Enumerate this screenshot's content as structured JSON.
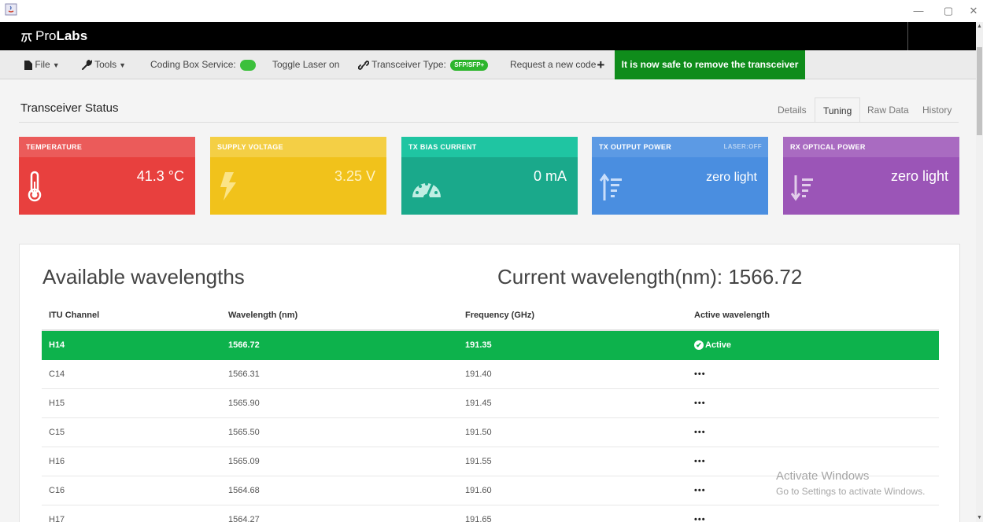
{
  "window": {
    "minimize_glyph": "—",
    "maximize_glyph": "▢",
    "close_glyph": "✕"
  },
  "brand": {
    "name_light": "Pro",
    "name_bold": "Labs"
  },
  "toolbar": {
    "file_label": "File",
    "tools_label": "Tools",
    "coding_box_label": "Coding Box Service:",
    "toggle_laser_label": "Toggle Laser on",
    "transceiver_type_label": "Transceiver Type:",
    "transceiver_type_badge": "SFP/SFP+",
    "request_code_label": "Request a new code",
    "safe_remove_banner": "It is now safe to remove the transceiver"
  },
  "status": {
    "title": "Transceiver Status",
    "tabs": [
      "Details",
      "Tuning",
      "Raw Data",
      "History"
    ],
    "active_tab": "Tuning"
  },
  "tiles": {
    "temperature": {
      "label": "TEMPERATURE",
      "value": "41.3 °C",
      "color": "#e8403e",
      "head_color": "#eb5b5a",
      "icon": "thermometer-icon"
    },
    "voltage": {
      "label": "SUPPLY VOLTAGE",
      "value": "3.25 V",
      "color": "#f1c21b",
      "head_color": "#f4cf45",
      "icon": "lightning-icon"
    },
    "bias": {
      "label": "TX BIAS CURRENT",
      "value": "0 mA",
      "color": "#1aa98b",
      "head_color": "#1fc5a2",
      "icon": "gauge-icon"
    },
    "tx_power": {
      "label": "TX OUTPUT POWER",
      "badge": "LASER:OFF",
      "value": "zero light",
      "color": "#4a8ee0",
      "head_color": "#5c9ae4",
      "icon": "sort-ascending-icon"
    },
    "rx_power": {
      "label": "RX OPTICAL POWER",
      "value": "zero light",
      "color": "#9b55b7",
      "head_color": "#a96bc1",
      "icon": "sort-descending-icon"
    }
  },
  "wavelengths": {
    "title": "Available wavelengths",
    "current": "Current wavelength(nm): 1566.72",
    "columns": [
      "ITU Channel",
      "Wavelength (nm)",
      "Frequency (GHz)",
      "Active wavelength"
    ],
    "rows": [
      {
        "channel": "H14",
        "wavelength": "1566.72",
        "frequency": "191.35",
        "active": "Active"
      },
      {
        "channel": "C14",
        "wavelength": "1566.31",
        "frequency": "191.40",
        "active": "•••"
      },
      {
        "channel": "H15",
        "wavelength": "1565.90",
        "frequency": "191.45",
        "active": "•••"
      },
      {
        "channel": "C15",
        "wavelength": "1565.50",
        "frequency": "191.50",
        "active": "•••"
      },
      {
        "channel": "H16",
        "wavelength": "1565.09",
        "frequency": "191.55",
        "active": "•••"
      },
      {
        "channel": "C16",
        "wavelength": "1564.68",
        "frequency": "191.60",
        "active": "•••"
      },
      {
        "channel": "H17",
        "wavelength": "1564.27",
        "frequency": "191.65",
        "active": "•••"
      }
    ]
  },
  "watermark": {
    "line1": "Activate Windows",
    "line2": "Go to Settings to activate Windows."
  }
}
